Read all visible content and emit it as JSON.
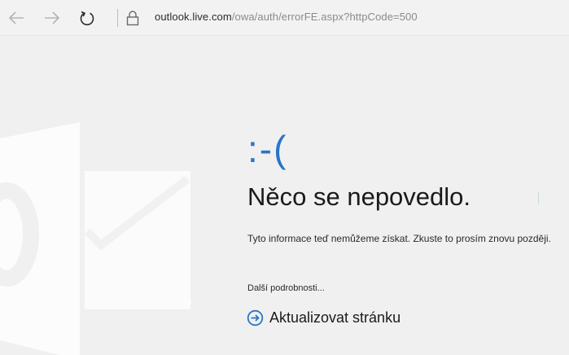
{
  "browser": {
    "back_icon": "arrow-left-icon",
    "forward_icon": "arrow-right-icon",
    "refresh_icon": "refresh-icon",
    "lock_icon": "lock-icon",
    "url_host": "outlook.live.com",
    "url_path": "/owa/auth/errorFE.aspx?httpCode=500"
  },
  "error_page": {
    "emoticon": ":-(",
    "heading": "Něco se nepovedlo.",
    "message": "Tyto informace teď nemůžeme získat. Zkuste to prosím znovu později.",
    "details_link": "Další podrobnosti...",
    "refresh_label": "Aktualizovat stránku",
    "refresh_icon": "circle-arrow-right-icon",
    "watermark_icon": "outlook-logo-icon",
    "watermark_trademark": "TM"
  },
  "colors": {
    "accent": "#2775c7",
    "background": "#f0f0f0",
    "text": "#1a1a1a"
  }
}
